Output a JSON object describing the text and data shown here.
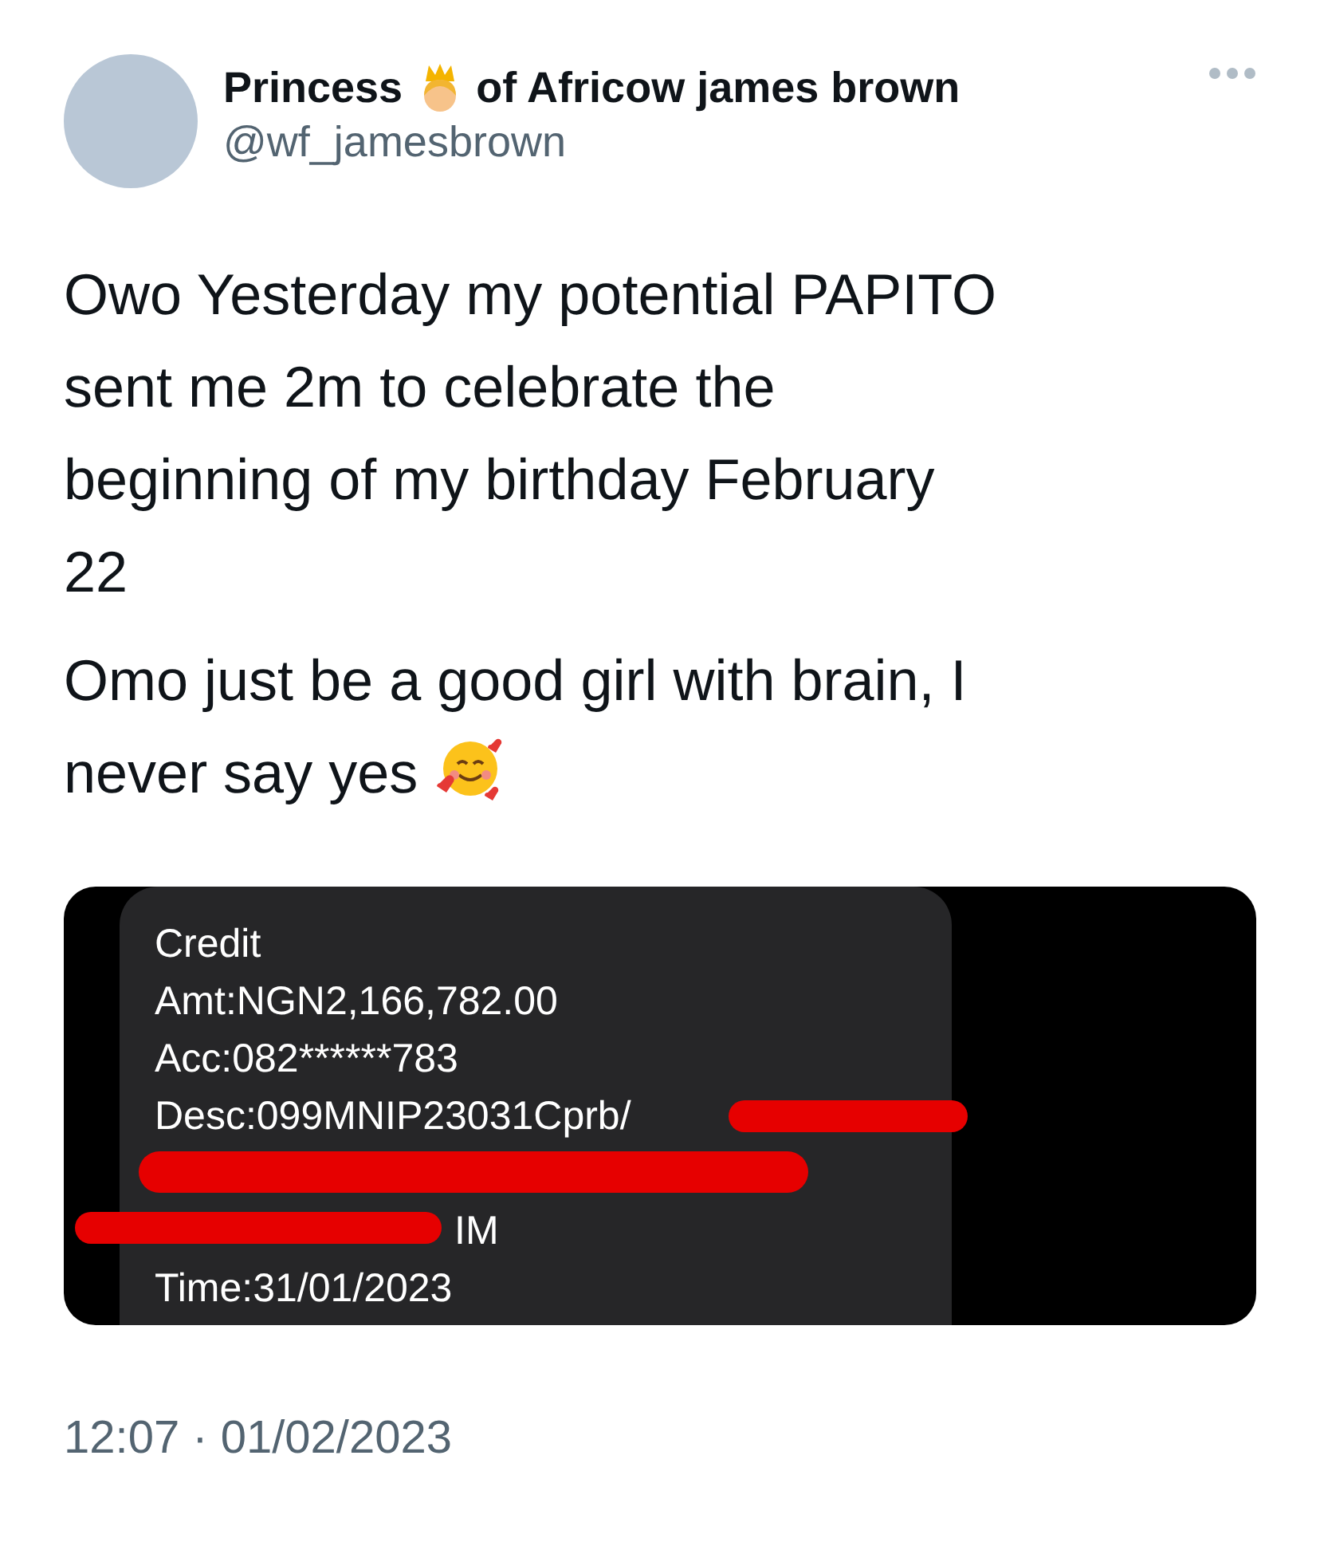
{
  "author": {
    "name_before_emoji": "Princess",
    "name_after_emoji": "of Africow james brown",
    "handle": "@wf_jamesbrown"
  },
  "paragraphs": [
    {
      "lines": [
        "Owo Yesterday my potential PAPITO",
        "sent me 2m to celebrate the",
        "beginning of my birthday February",
        "22"
      ]
    },
    {
      "lines": [
        "Omo just be a good girl with brain, I",
        "never say yes"
      ]
    }
  ],
  "attached_screenshot": {
    "lines": [
      {
        "kind": "text",
        "text": "Credit"
      },
      {
        "kind": "text",
        "text": "Amt:NGN2,166,782.00"
      },
      {
        "kind": "text",
        "text": "Acc:082******783"
      },
      {
        "kind": "redacted_tail",
        "text": "Desc:099MNIP23031Cprb/"
      },
      {
        "kind": "redacted"
      },
      {
        "kind": "redacted_head",
        "text": "IM"
      },
      {
        "kind": "text",
        "text": "Time:31/01/2023"
      }
    ]
  },
  "timestamp": "12:07 · 01/02/2023"
}
